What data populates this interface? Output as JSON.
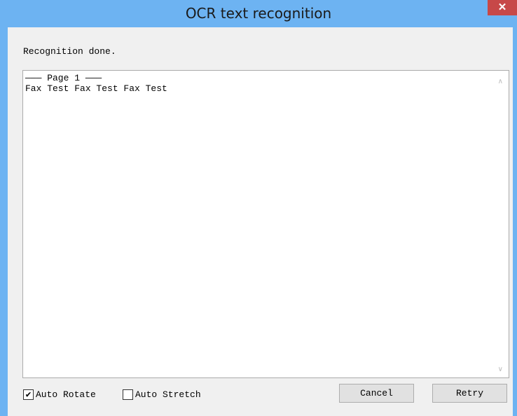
{
  "window": {
    "title": "OCR text recognition",
    "close_label": "✕"
  },
  "status_text": "Recognition done.",
  "result_text": "——— Page 1 ———\nFax Test Fax Test Fax Test",
  "options": {
    "auto_rotate": {
      "label": "Auto Rotate",
      "checked": true
    },
    "auto_stretch": {
      "label": "Auto Stretch",
      "checked": false
    }
  },
  "buttons": {
    "cancel": "Cancel",
    "retry": "Retry"
  },
  "icons": {
    "close": "close-icon",
    "scroll_up": "chevron-up-icon",
    "scroll_down": "chevron-down-icon",
    "check": "checkmark-icon"
  },
  "colors": {
    "titlebar": "#6db3f2",
    "close_button": "#c74848"
  }
}
